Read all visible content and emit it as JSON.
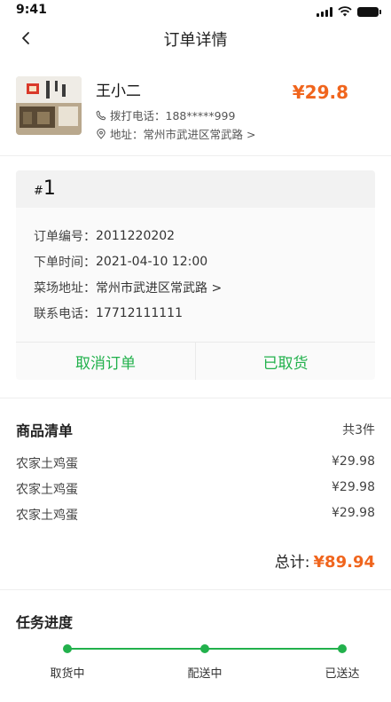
{
  "status_bar": {
    "time": "9:41"
  },
  "nav": {
    "title": "订单详情"
  },
  "shop": {
    "name": "王小二",
    "price": "¥29.8",
    "phone_text": "拨打电话：188*****999",
    "address_text": "地址：常州市武进区常武路 >"
  },
  "order": {
    "number_prefix": "#",
    "number": "1",
    "fields": [
      {
        "label": "订单编号：",
        "value": "2011220202"
      },
      {
        "label": "下单时间：",
        "value": "2021-04-10 12:00"
      },
      {
        "label": "菜场地址：",
        "value": "常州市武进区常武路 >"
      },
      {
        "label": "联系电话：",
        "value": "17712111111"
      }
    ],
    "cancel_label": "取消订单",
    "picked_label": "已取货"
  },
  "goods": {
    "title": "商品清单",
    "count": "共3件",
    "items": [
      {
        "name": "农家土鸡蛋",
        "price": "¥29.98"
      },
      {
        "name": "农家土鸡蛋",
        "price": "¥29.98"
      },
      {
        "name": "农家土鸡蛋",
        "price": "¥29.98"
      }
    ],
    "total_label": "总计:",
    "total_value": "¥89.94"
  },
  "progress": {
    "title": "任务进度",
    "steps": [
      {
        "label": "取货中"
      },
      {
        "label": "配送中"
      },
      {
        "label": "已送达"
      }
    ]
  },
  "colors": {
    "accent_green": "#22b14c",
    "price_orange": "#f0651d"
  }
}
